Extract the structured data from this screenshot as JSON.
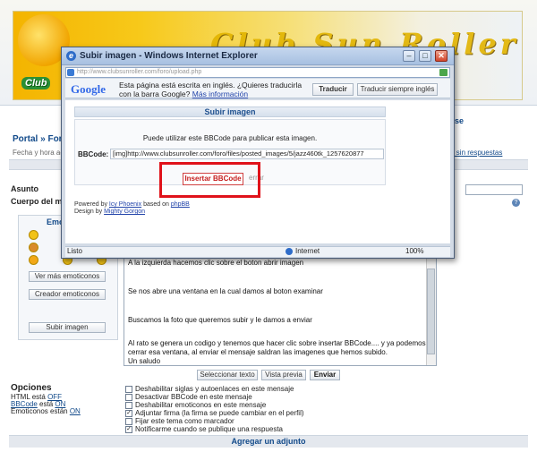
{
  "forum": {
    "logo_text": "Club",
    "logo_script": "Club Sun Roller",
    "nav_right": "se",
    "breadcrumb": [
      "Portal",
      "Foro"
    ],
    "breadcrumb_sep": "»",
    "date_text": "Fecha y hora act",
    "unanswered_link": "ensajes sin respuestas",
    "subject_label": "Asunto",
    "body_label": "Cuerpo del me",
    "emoticons_title": "Emoti",
    "more_emoticons": "Ver más emoticonos",
    "emoticon_creator": "Creador emoticonos",
    "upload_image": "Subir imagen",
    "message_lines": [
      "A la izquierda hacemos clic sobre el boton abrir imagen",
      "Se nos abre una ventana en la cual damos al boton examinar",
      "Buscamos la foto que queremos subir y le damos a enviar",
      "Al rato se genera un codigo y tenemos que hacer clic sobre insertar BBCode.... y ya podemos cerrar esa ventana, al enviar el mensaje saldran las imagenes que hemos subido.",
      "Un saludo"
    ],
    "buttons": {
      "spellcheck": "Seleccionar texto",
      "preview": "Vista previa",
      "submit": "Enviar"
    },
    "options": {
      "title": "Opciones",
      "html_status": "HTML está",
      "html_value": "OFF",
      "bbcode_label": "BBCode",
      "bbcode_status": "está",
      "bbcode_value": "ON",
      "emoticons_status": "Emoticonos están",
      "emoticons_value": "ON"
    },
    "checkboxes": [
      {
        "label": "Deshabilitar siglas y autoenlaces en este mensaje",
        "checked": false
      },
      {
        "label": "Desactivar BBCode en este mensaje",
        "checked": false
      },
      {
        "label": "Deshabilitar emoticonos en este mensaje",
        "checked": false
      },
      {
        "label": "Adjuntar firma (la firma se puede cambiar en el perfil)",
        "checked": true
      },
      {
        "label": "Fijar este tema como marcador",
        "checked": false
      },
      {
        "label": "Notificarme cuando se publique una respuesta",
        "checked": true
      }
    ],
    "attach_bar": "Agregar un adjunto"
  },
  "popup": {
    "title": "Subir imagen - Windows Internet Explorer",
    "url": "http://www.clubsunroller.com/foro/upload.php",
    "google": {
      "logo": "Google",
      "message": "Esta página está escrita en inglés. ¿Quieres traducirla con la barra Google?",
      "more_info": "Más información",
      "translate": "Traducir",
      "always_translate": "Traducir siempre inglés"
    },
    "upload_title": "Subir imagen",
    "bbcode_hint": "Puede utilizar este BBCode para publicar esta imagen.",
    "bbcode_label": "BBCode:",
    "bbcode_value": "[img]http://www.clubsunroller.com/foro/files/posted_images/5/jazz460tk_1257620877",
    "insert_button": "Insertar BBCode",
    "close_button": "errar",
    "powered_line1_prefix": "Powered by",
    "powered_link1": "Icy Phoenix",
    "powered_mid": "based on",
    "powered_link2": "phpBB",
    "powered_line2_prefix": "Design by",
    "powered_link3": "Mighty Gorgon",
    "status_left": "Listo",
    "status_zone": "Internet",
    "status_zoom": "100%"
  }
}
